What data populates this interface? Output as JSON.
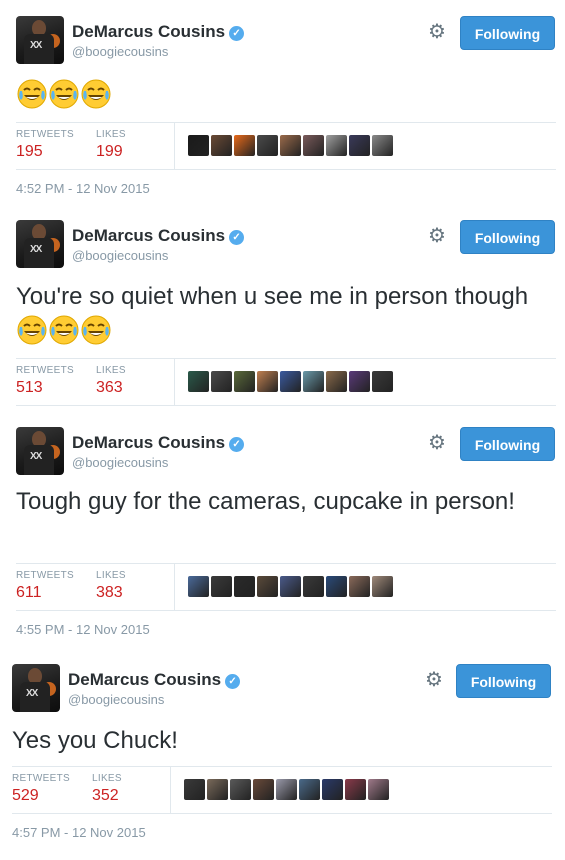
{
  "tweets": [
    {
      "name": "DeMarcus Cousins",
      "handle": "@boogiecousins",
      "follow_label": "Following",
      "text": "",
      "emoji_count": 3,
      "retweets_label": "RETWEETS",
      "retweets": "195",
      "likes_label": "LIKES",
      "likes": "199",
      "timestamp": "4:52 PM - 12 Nov 2015",
      "liker_colors": [
        "#1a1a1a",
        "#6b4a35",
        "#e86a1a",
        "#4a4a4a",
        "#9a6a4a",
        "#7a5a5a",
        "#a0a0a0",
        "#3a3a5a",
        "#8a8a8a"
      ]
    },
    {
      "name": "DeMarcus Cousins",
      "handle": "@boogiecousins",
      "follow_label": "Following",
      "text": "You're so quiet when u see me in person though",
      "emoji_count": 3,
      "retweets_label": "RETWEETS",
      "retweets": "513",
      "likes_label": "LIKES",
      "likes": "363",
      "timestamp": "",
      "liker_colors": [
        "#2a5a4a",
        "#4a4a4a",
        "#5a6a3a",
        "#c08050",
        "#3a5aa0",
        "#6a9aaa",
        "#8a6a4a",
        "#5a3a7a",
        "#3a3a3a"
      ]
    },
    {
      "name": "DeMarcus Cousins",
      "handle": "@boogiecousins",
      "follow_label": "Following",
      "text": "Tough guy for the cameras, cupcake in person!",
      "emoji_count": 0,
      "retweets_label": "RETWEETS",
      "retweets": "611",
      "likes_label": "LIKES",
      "likes": "383",
      "timestamp": "4:55 PM - 12 Nov 2015",
      "liker_colors": [
        "#4a6a9a",
        "#3a3a3a",
        "#2a2a2a",
        "#5a4a3a",
        "#4a5a8a",
        "#3a3a3a",
        "#2a4a7a",
        "#8a6a5a",
        "#a08a7a"
      ]
    },
    {
      "name": "DeMarcus Cousins",
      "handle": "@boogiecousins",
      "follow_label": "Following",
      "text": "Yes you Chuck!",
      "emoji_count": 0,
      "retweets_label": "RETWEETS",
      "retweets": "529",
      "likes_label": "LIKES",
      "likes": "352",
      "timestamp": "4:57 PM - 12 Nov 2015",
      "liker_colors": [
        "#3a3a3a",
        "#7a6a5a",
        "#5a5a5a",
        "#6a4a3a",
        "#9a9aaa",
        "#4a6a8a",
        "#2a3a6a",
        "#8a3a4a",
        "#a07a8a"
      ]
    }
  ]
}
